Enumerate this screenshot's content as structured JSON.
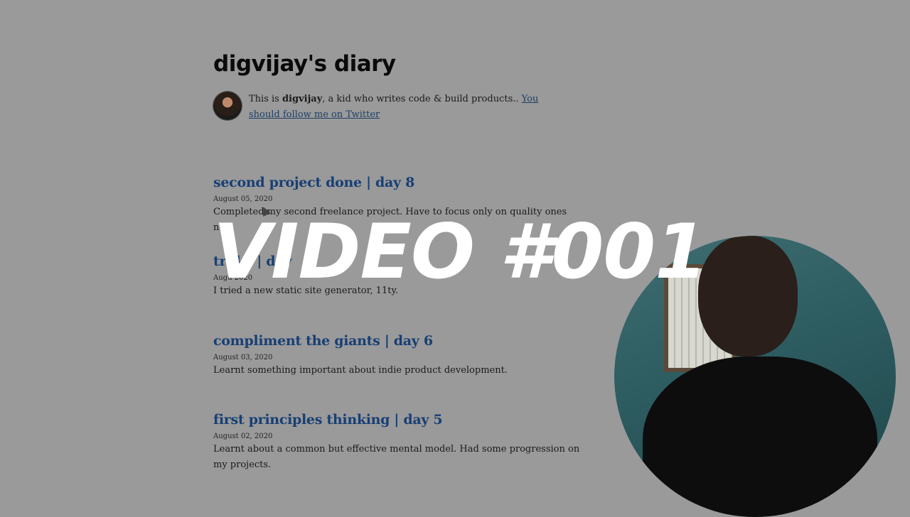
{
  "site": {
    "title": "digvijay's diary",
    "bio_prefix": "This is ",
    "bio_name": "digvijay",
    "bio_middle": ", a kid who writes code & build products.. ",
    "bio_link": "You should follow me on Twitter"
  },
  "posts": [
    {
      "title": "second project done | day 8",
      "date": "August 05, 2020",
      "desc": "Completed my second freelance project. Have to focus only on quality ones now."
    },
    {
      "title": "tri   ky | day",
      "date": "Augu   2020",
      "desc": "I tried a new static site generator, 11ty."
    },
    {
      "title": "compliment the giants | day 6",
      "date": "August 03, 2020",
      "desc": "Learnt something important about indie product development."
    },
    {
      "title": "first principles thinking | day 5",
      "date": "August 02, 2020",
      "desc": "Learnt about a common but effective mental model. Had some progression on my projects."
    }
  ],
  "overlay": {
    "text": "VIDEO #001"
  },
  "colors": {
    "background": "#9a9a9a",
    "link": "#173f74",
    "overlay_text": "#ffffff"
  },
  "icons": {
    "cursor": "mouse-pointer-icon",
    "avatar": "profile-avatar",
    "webcam": "webcam-feed"
  }
}
